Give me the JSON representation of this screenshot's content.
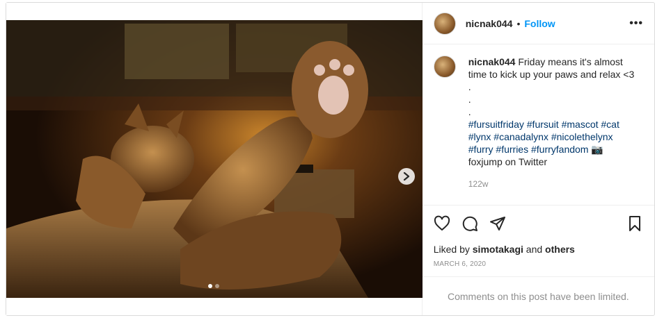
{
  "header": {
    "username": "nicnak044",
    "separator": "•",
    "follow_label": "Follow",
    "more_glyph": "•••"
  },
  "caption": {
    "username": "nicnak044",
    "line1": "Friday means it's almost time to kick up your paws and relax <3 .",
    "dot1": ".",
    "dot2": ".",
    "hashtags": [
      "#fursuitfriday",
      "#fursuit",
      "#mascot",
      "#cat",
      "#lynx",
      "#canadalynx",
      "#nicolethelynx",
      "#furry",
      "#furries",
      "#furryfandom"
    ],
    "camera_emoji": "📷",
    "credit": "foxjump on Twitter",
    "time_ago": "122w"
  },
  "actions": {
    "icons": [
      "heart-icon",
      "comment-icon",
      "share-icon",
      "bookmark-icon"
    ]
  },
  "likes": {
    "prefix": "Liked by",
    "user": "simotakagi",
    "conj": "and",
    "others": "others"
  },
  "date": "MARCH 6, 2020",
  "comments_limited": "Comments on this post have been limited.",
  "carousel": {
    "current": 1,
    "total": 2
  },
  "colors": {
    "link": "#0095f6",
    "hashtag": "#00376b",
    "muted": "#8e8e8e"
  }
}
